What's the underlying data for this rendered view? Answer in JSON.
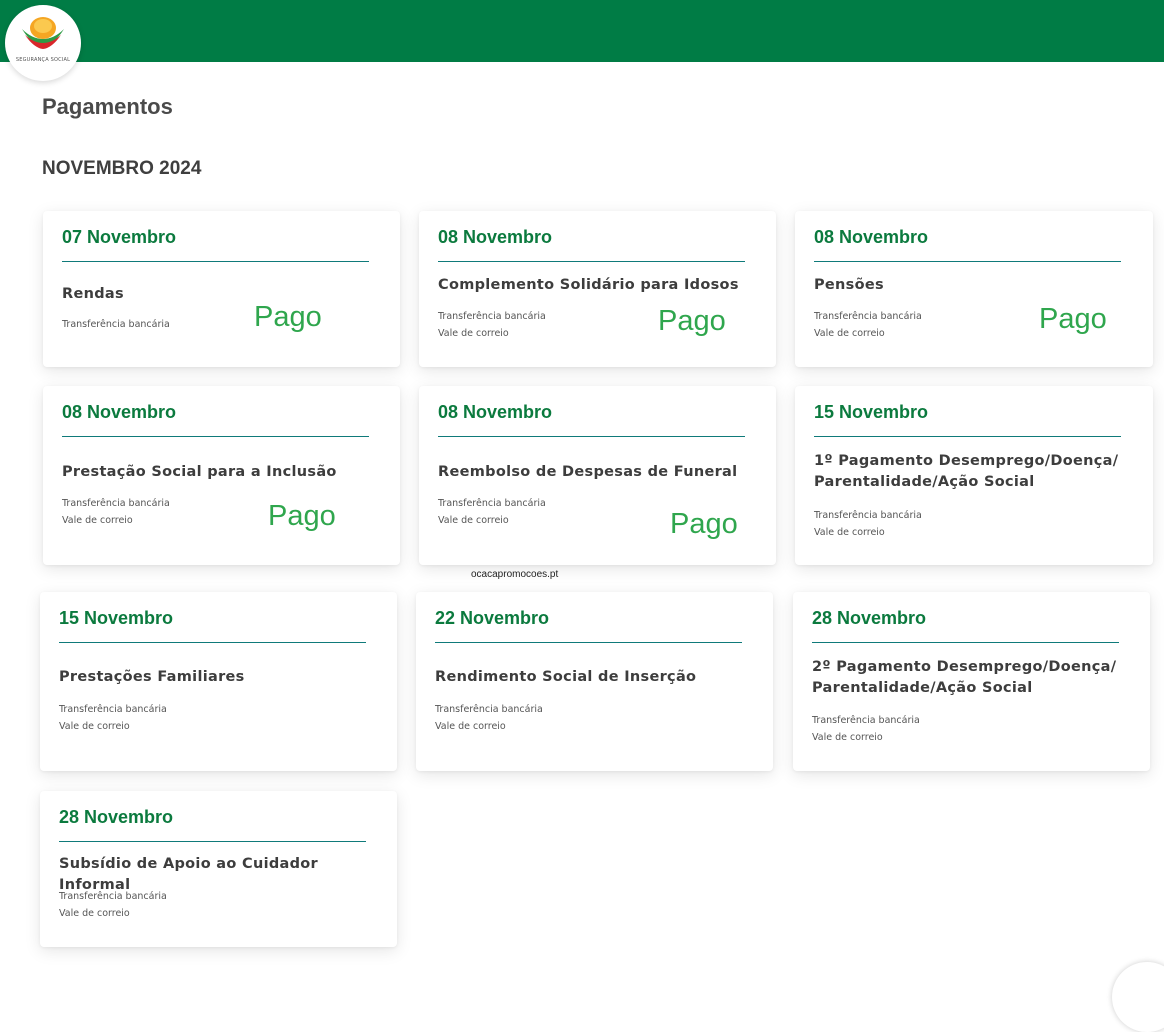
{
  "header": {
    "logo_text": "SEGURANÇA SOCIAL"
  },
  "page": {
    "title": "Pagamentos",
    "month": "NOVEMBRO 2024",
    "watermark": "ocacapromocoes.pt"
  },
  "colors": {
    "brand_green": "#007c45",
    "date_green": "#0b7a3e",
    "paid_green": "#2fa64d"
  },
  "cards": [
    {
      "date": "07 Novembro",
      "title": "Rendas",
      "methods": [
        "Transferência bancária"
      ],
      "status": "Pago"
    },
    {
      "date": "08 Novembro",
      "title": "Complemento Solidário para Idosos",
      "methods": [
        "Transferência bancária",
        "Vale de correio"
      ],
      "status": "Pago"
    },
    {
      "date": "08 Novembro",
      "title": "Pensões",
      "methods": [
        "Transferência bancária",
        "Vale de correio"
      ],
      "status": "Pago"
    },
    {
      "date": "08 Novembro",
      "title": "Prestação Social para a Inclusão",
      "methods": [
        "Transferência bancária",
        "Vale de correio"
      ],
      "status": "Pago"
    },
    {
      "date": "08 Novembro",
      "title": "Reembolso de Despesas de Funeral",
      "methods": [
        "Transferência bancária",
        "Vale de correio"
      ],
      "status": "Pago"
    },
    {
      "date": "15 Novembro",
      "title": "1º Pagamento Desemprego/Doença/ Parentalidade/Ação Social",
      "methods": [
        "Transferência bancária",
        "Vale de correio"
      ],
      "status": ""
    },
    {
      "date": "15 Novembro",
      "title": "Prestações Familiares",
      "methods": [
        "Transferência bancária",
        "Vale de correio"
      ],
      "status": ""
    },
    {
      "date": "22 Novembro",
      "title": "Rendimento Social de Inserção",
      "methods": [
        "Transferência bancária",
        "Vale de correio"
      ],
      "status": ""
    },
    {
      "date": "28 Novembro",
      "title": "2º Pagamento Desemprego/Doença/ Parentalidade/Ação Social",
      "methods": [
        "Transferência bancária",
        "Vale de correio"
      ],
      "status": ""
    },
    {
      "date": "28 Novembro",
      "title": "Subsídio de Apoio ao Cuidador Informal",
      "methods": [
        "Transferência bancária",
        "Vale de correio"
      ],
      "status": ""
    }
  ]
}
